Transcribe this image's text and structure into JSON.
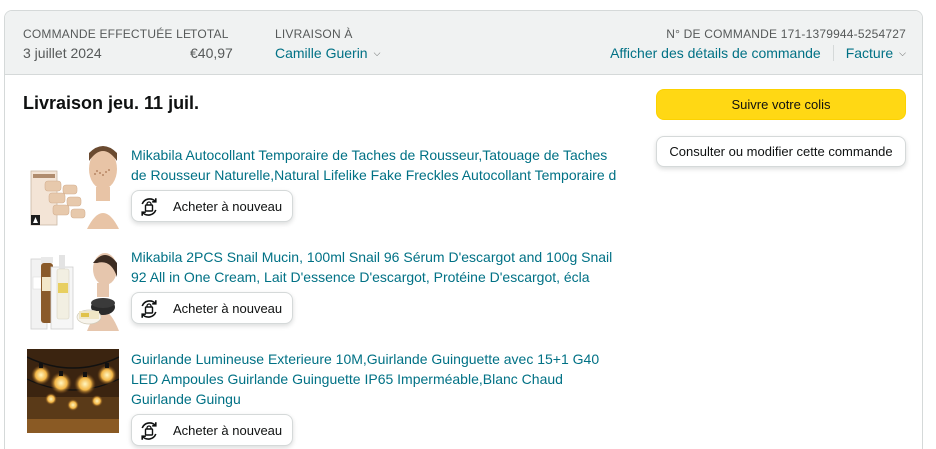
{
  "header": {
    "date_label": "COMMANDE EFFECTUÉE LE",
    "date_value": "3 juillet 2024",
    "total_label": "TOTAL",
    "total_value": "€40,97",
    "ship_label": "LIVRAISON À",
    "ship_value": "Camille Guerin",
    "order_label": "N° DE COMMANDE 171-1379944-5254727",
    "details_link": "Afficher des détails de commande",
    "invoice_link": "Facture"
  },
  "delivery": {
    "title": "Livraison jeu. 11 juil."
  },
  "actions": {
    "track": "Suivre votre colis",
    "modify": "Consulter ou modifier cette commande"
  },
  "items": [
    {
      "title": "Mikabila Autocollant Temporaire de Taches de Rousseur,Tatouage de Taches de Rousseur Naturelle,Natural Lifelike Fake Freckles Autocollant Temporaire d",
      "buy_again": "Acheter à nouveau"
    },
    {
      "title": "Mikabila 2PCS Snail Mucin, 100ml Snail 96 Sérum D'escargot and 100g Snail 92 All in One Cream, Lait D'essence D'escargot, Protéine D'escargot, écla",
      "buy_again": "Acheter à nouveau"
    },
    {
      "title": "Guirlande Lumineuse Exterieure 10M,Guirlande Guinguette avec 15+1 G40 LED Ampoules Guirlande Guinguette IP65 Imperméable,Blanc Chaud Guirlande Guingu",
      "buy_again": "Acheter à nouveau"
    }
  ],
  "colors": {
    "link": "#007185",
    "track_button": "#FFD814",
    "header_bg": "#F0F2F2",
    "border": "#D5D9D9"
  },
  "icons": {
    "buy_again": "reorder-bag-icon",
    "dropdown": "chevron-down-icon"
  }
}
